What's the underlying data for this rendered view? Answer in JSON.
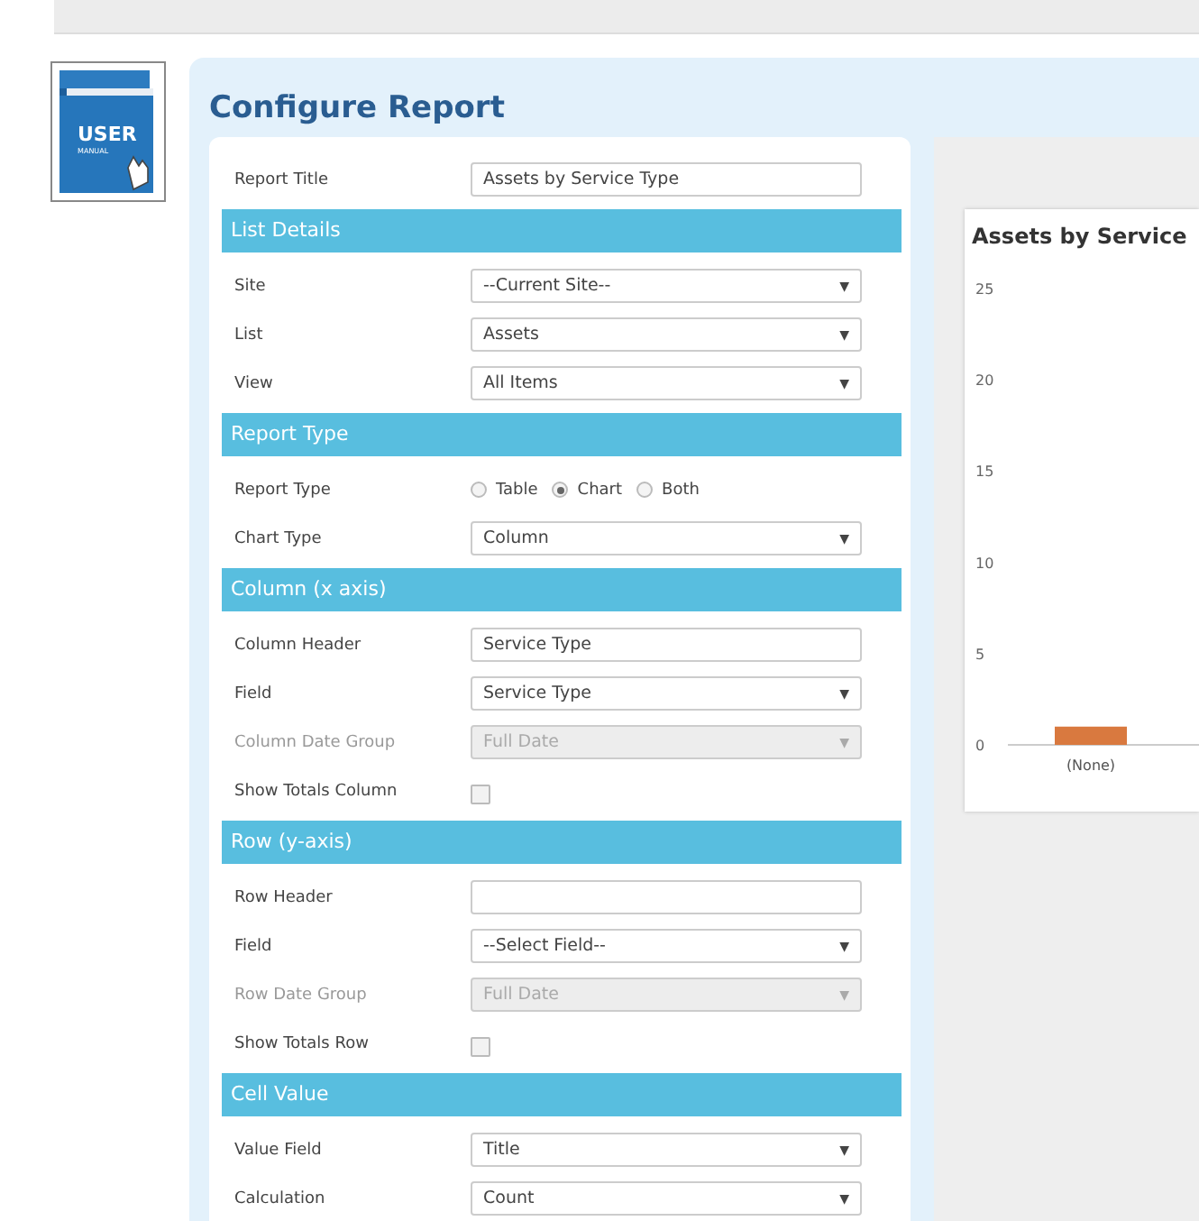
{
  "manual_icon": {
    "words": [
      "USER",
      "MANUAL"
    ]
  },
  "title": "Configure Report",
  "report_title": {
    "label": "Report Title",
    "value": "Assets by Service Type"
  },
  "sections": [
    {
      "title": "List Details",
      "rows": [
        {
          "kind": "select",
          "label": "Site",
          "value": "--Current Site--",
          "arrow": "▼",
          "disabled": false
        },
        {
          "kind": "select",
          "label": "List",
          "value": "Assets",
          "arrow": "▼",
          "disabled": false
        },
        {
          "kind": "select",
          "label": "View",
          "value": "All Items",
          "arrow": "▼",
          "disabled": false
        }
      ]
    },
    {
      "title": "Report Type",
      "rows": [
        {
          "kind": "radio",
          "label": "Report Type",
          "options": [
            {
              "label": "Table",
              "selected": false
            },
            {
              "label": "Chart",
              "selected": true
            },
            {
              "label": "Both",
              "selected": false
            }
          ]
        },
        {
          "kind": "select",
          "label": "Chart Type",
          "value": "Column",
          "arrow": "▼",
          "disabled": false
        }
      ]
    },
    {
      "title": "Column (x axis)",
      "rows": [
        {
          "kind": "text",
          "label": "Column Header",
          "value": "Service Type"
        },
        {
          "kind": "select",
          "label": "Field",
          "value": "Service Type",
          "arrow": "▼",
          "disabled": false
        },
        {
          "kind": "select",
          "label": "Column Date Group",
          "value": "Full Date",
          "arrow": "▼",
          "disabled": true
        },
        {
          "kind": "checkbox",
          "label": "Show Totals Column",
          "checked": false
        }
      ]
    },
    {
      "title": "Row (y-axis)",
      "rows": [
        {
          "kind": "text",
          "label": "Row Header",
          "value": ""
        },
        {
          "kind": "select",
          "label": "Field",
          "value": "--Select Field--",
          "arrow": "▼",
          "disabled": false
        },
        {
          "kind": "select",
          "label": "Row Date Group",
          "value": "Full Date",
          "arrow": "▼",
          "disabled": true
        },
        {
          "kind": "checkbox",
          "label": "Show Totals Row",
          "checked": false
        }
      ]
    },
    {
      "title": "Cell Value",
      "rows": [
        {
          "kind": "select",
          "label": "Value Field",
          "value": "Title",
          "arrow": "▼",
          "disabled": false
        },
        {
          "kind": "select",
          "label": "Calculation",
          "value": "Count",
          "arrow": "▼",
          "disabled": false
        }
      ]
    }
  ],
  "chart": {
    "chart_data": {
      "type": "bar",
      "title": "Assets by Service",
      "categories": [
        "(None)"
      ],
      "values": [
        1
      ],
      "ylim": [
        0,
        25
      ],
      "yticks": [
        0,
        5,
        10,
        15,
        20,
        25
      ]
    }
  }
}
